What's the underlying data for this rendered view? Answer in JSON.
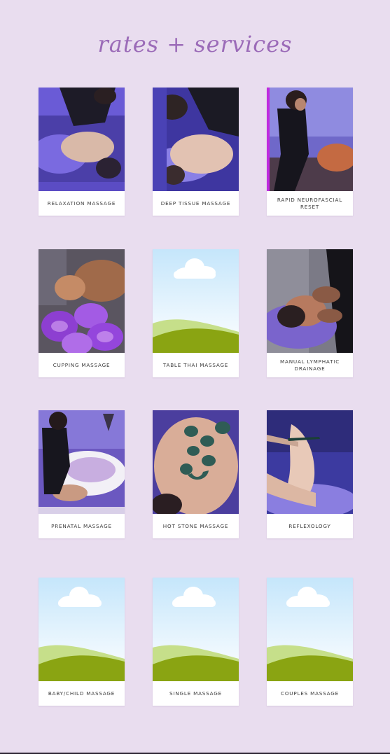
{
  "header": {
    "title": "rates + services"
  },
  "colors": {
    "page_background": "#e9ddef",
    "title_color": "#9b6bb8",
    "card_background": "#ffffff",
    "label_color": "#3a3a3a"
  },
  "services": [
    {
      "label": "RELAXATION MASSAGE",
      "image": "massage-photo"
    },
    {
      "label": "DEEP TISSUE MASSAGE",
      "image": "massage-photo"
    },
    {
      "label": "RAPID NEUROFASCIAL RESET",
      "image": "massage-photo"
    },
    {
      "label": "CUPPING MASSAGE",
      "image": "cupping-photo"
    },
    {
      "label": "TABLE THAI MASSAGE",
      "image": "placeholder-landscape"
    },
    {
      "label": "MANUAL LYMPHATIC DRAINAGE",
      "image": "massage-photo"
    },
    {
      "label": "PRENATAL MASSAGE",
      "image": "massage-photo"
    },
    {
      "label": "HOT STONE MASSAGE",
      "image": "hot-stone-photo"
    },
    {
      "label": "REFLEXOLOGY",
      "image": "reflexology-photo"
    },
    {
      "label": "BABY/CHILD MASSAGE",
      "image": "placeholder-landscape"
    },
    {
      "label": "SINGLE MASSAGE",
      "image": "placeholder-landscape"
    },
    {
      "label": "COUPLES MASSAGE",
      "image": "placeholder-landscape"
    }
  ]
}
